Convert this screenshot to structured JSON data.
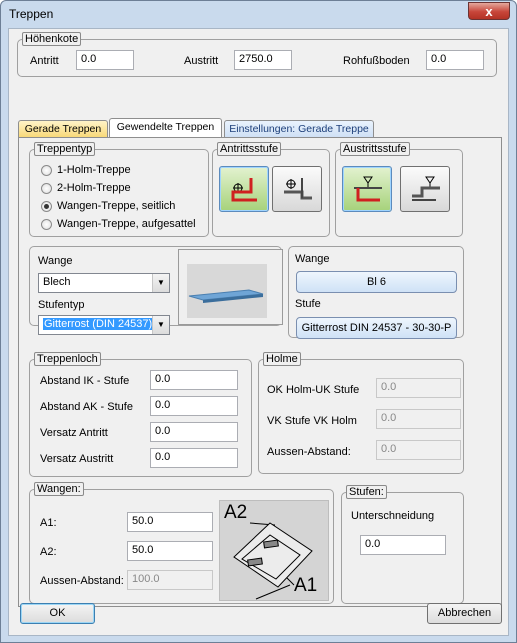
{
  "window": {
    "title": "Treppen",
    "close_label": "x"
  },
  "hoehenkote": {
    "legend": "Höhenkote",
    "antritt_label": "Antritt",
    "antritt_value": "0.0",
    "austritt_label": "Austritt",
    "austritt_value": "2750.0",
    "rohfuss_label": "Rohfußboden",
    "rohfuss_value": "0.0"
  },
  "tabs": [
    {
      "label": "Gerade Treppen"
    },
    {
      "label": "Gewendelte Treppen"
    },
    {
      "label": "Einstellungen: Gerade Treppe"
    }
  ],
  "treppentyp": {
    "legend": "Treppentyp",
    "options": [
      {
        "label": "1-Holm-Treppe",
        "checked": false
      },
      {
        "label": "2-Holm-Treppe",
        "checked": false
      },
      {
        "label": "Wangen-Treppe, seitlich",
        "checked": true
      },
      {
        "label": "Wangen-Treppe, aufgesattel",
        "checked": false
      }
    ]
  },
  "antrittsstufe": {
    "legend": "Antrittsstufe"
  },
  "austrittsstufe": {
    "legend": "Austrittsstufe"
  },
  "wange_left": {
    "wange_label": "Wange",
    "wange_value": "Blech",
    "stufentyp_label": "Stufentyp",
    "stufentyp_value": "Gitterrost (DIN 24537)"
  },
  "wange_right": {
    "wange_label": "Wange",
    "wange_button": "Bl 6",
    "stufe_label": "Stufe",
    "stufe_button": "Gitterrost DIN 24537 - 30-30-P"
  },
  "treppenloch": {
    "legend": "Treppenloch",
    "rows": [
      {
        "label": "Abstand IK - Stufe",
        "value": "0.0"
      },
      {
        "label": "Abstand AK - Stufe",
        "value": "0.0"
      },
      {
        "label": "Versatz Antritt",
        "value": "0.0"
      },
      {
        "label": "Versatz Austritt",
        "value": "0.0"
      }
    ]
  },
  "holme": {
    "legend": "Holme",
    "rows": [
      {
        "label": "OK Holm-UK Stufe",
        "value": "0.0"
      },
      {
        "label": "VK Stufe VK Holm",
        "value": "0.0"
      },
      {
        "label": "Aussen-Abstand:",
        "value": "0.0"
      }
    ]
  },
  "wangen": {
    "legend": "Wangen:",
    "a1_label": "A1:",
    "a1_value": "50.0",
    "a2_label": "A2:",
    "a2_value": "50.0",
    "aussen_label": "Aussen-Abstand:",
    "aussen_value": "100.0",
    "diagram_a1": "A1",
    "diagram_a2": "A2"
  },
  "stufen": {
    "legend": "Stufen:",
    "label": "Unterschneidung",
    "value": "0.0"
  },
  "buttons": {
    "ok": "OK",
    "cancel": "Abbrechen"
  }
}
